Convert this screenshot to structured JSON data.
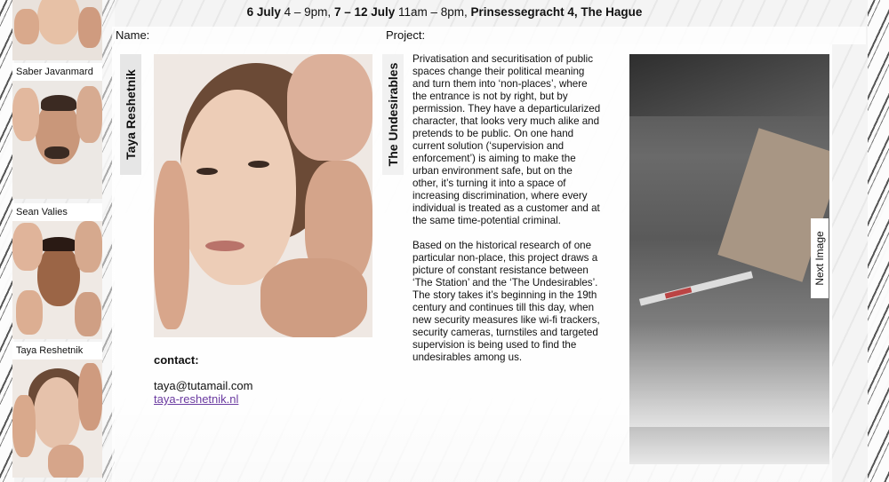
{
  "header": {
    "date1": "6 July",
    "time1": " 4 – 9pm, ",
    "date2": "7 – 12 July",
    "time2": " 11am – 8pm, ",
    "venue": "Prinsessegracht 4, The Hague"
  },
  "thumbnails": [
    {
      "name": ""
    },
    {
      "name": "Saber Javanmard"
    },
    {
      "name": "Sean Valies"
    },
    {
      "name": "Taya Reshetnik"
    }
  ],
  "labels": {
    "name": "Name:",
    "project": "Project:"
  },
  "student": {
    "name": "Taya Reshetnik",
    "contact_title": "contact:",
    "email": "taya@tutamail.com",
    "website": "taya-reshetnik.nl"
  },
  "project": {
    "title": "The Undesirables",
    "paragraph1": "Privatisation and securitisation of public spaces change their political meaning and turn them into ‘non-places’, where the entrance is not by right, but by permission. They have a departicularized character, that looks very much alike and pretends to be public. On one hand current solution (‘supervision and enforcement’) is aiming to make the urban environment safe, but on the other, it’s turning it into a space of increasing discrimination, where every individual is treated as a customer and at the same time-potential criminal.",
    "paragraph2": "Based on the historical research of one particular non-place, this project draws a picture of constant resistance between ‘The Station’ and the ‘The Undesirables’. The story takes it’s beginning in the 19th century and continues till this day, when new security measures like wi-fi trackers, security cameras, turnstiles and targeted supervision is being used to find the undesirables among us.",
    "next_label": "Next Image"
  },
  "colors": {
    "link": "#6a3aa0",
    "label_bg": "#e6e6e6"
  }
}
